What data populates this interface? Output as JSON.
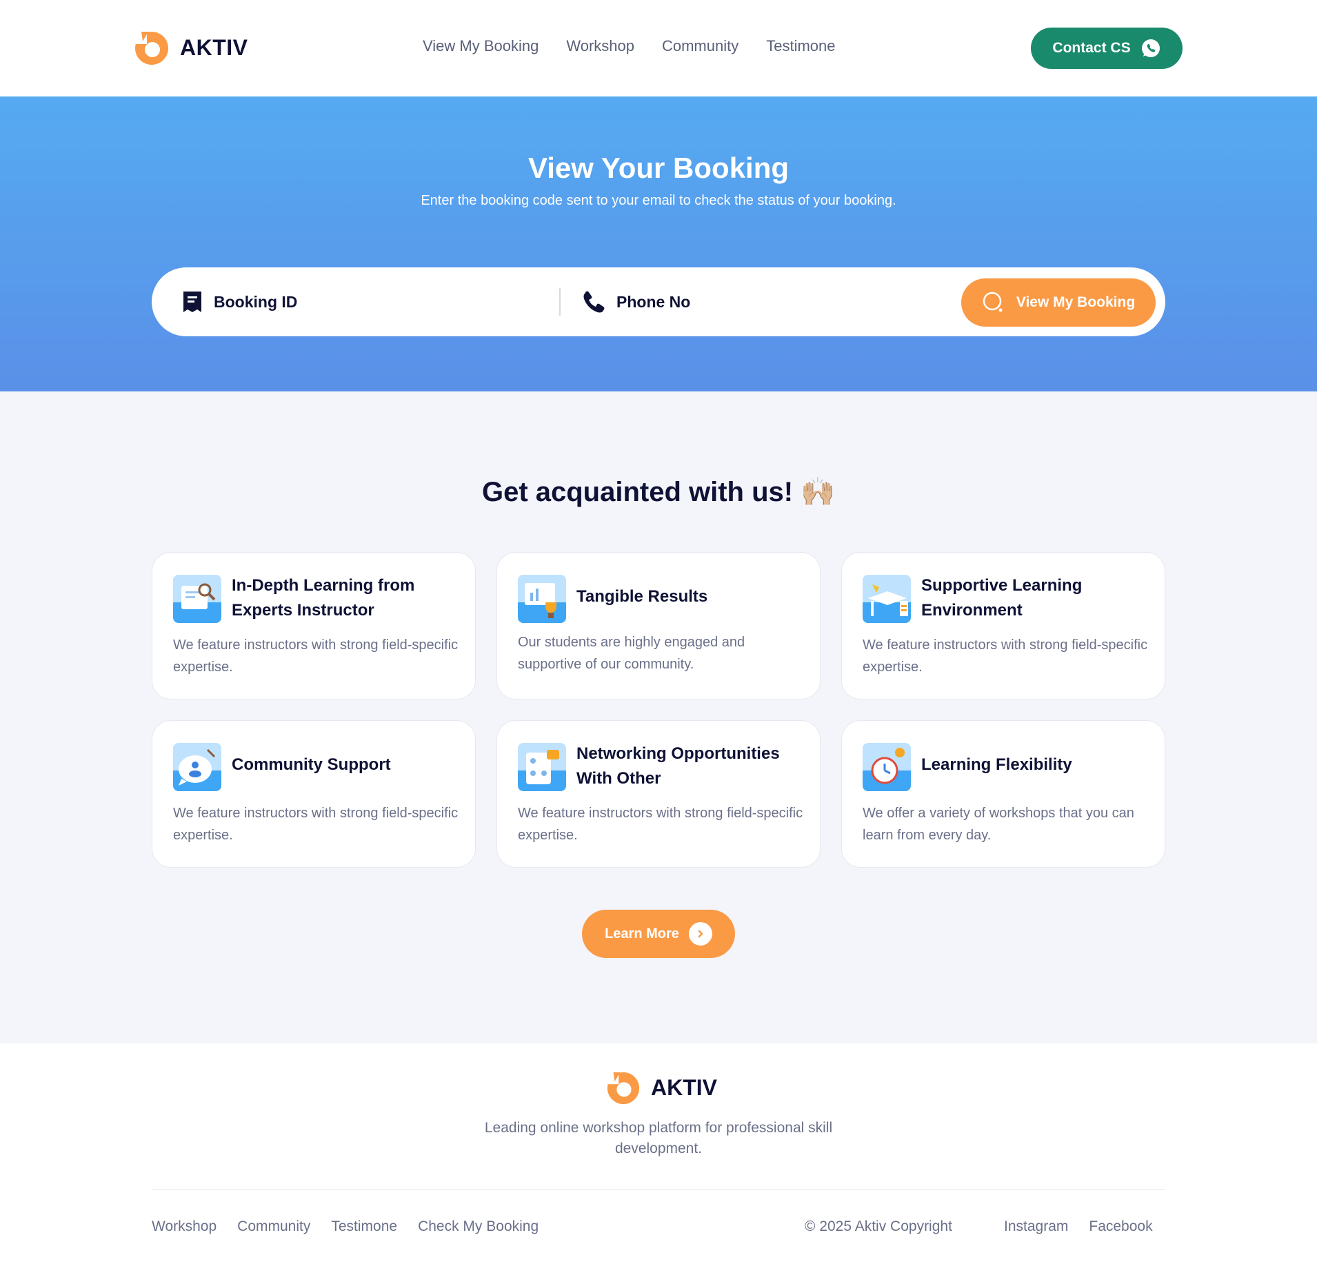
{
  "header": {
    "brand": "AKTIV",
    "nav": [
      "View My Booking",
      "Workshop",
      "Community",
      "Testimone"
    ],
    "contact_label": "Contact CS"
  },
  "hero": {
    "title": "View Your Booking",
    "subtitle": "Enter the booking code sent to your email to check the status of your booking.",
    "booking_placeholder": "Booking ID",
    "booking_value": "",
    "phone_placeholder": "Phone No",
    "phone_value": "",
    "button_label": "View My Booking"
  },
  "features": {
    "title": "Get acquainted with us!",
    "emoji": "🙌🏼",
    "cards": [
      {
        "title": "In-Depth Learning from Experts Instructor",
        "desc": "We feature instructors with strong field-specific expertise.",
        "icon": "expert-instructor-icon"
      },
      {
        "title": "Tangible Results",
        "desc": "Our students are highly engaged and supportive of our community.",
        "icon": "trophy-results-icon"
      },
      {
        "title": "Supportive Learning Environment",
        "desc": "We feature instructors with strong field-specific expertise.",
        "icon": "desk-environment-icon"
      },
      {
        "title": "Community Support",
        "desc": "We feature instructors with strong field-specific expertise.",
        "icon": "chat-community-icon"
      },
      {
        "title": "Networking Opportunities With Other",
        "desc": "We feature instructors with strong field-specific expertise.",
        "icon": "networking-card-icon"
      },
      {
        "title": "Learning Flexibility",
        "desc": "We offer a variety of workshops that you can learn from every day.",
        "icon": "alarm-clock-icon"
      }
    ],
    "learn_more": "Learn More"
  },
  "footer": {
    "brand": "AKTIV",
    "tagline": "Leading online workshop platform for professional skill development.",
    "links": [
      "Workshop",
      "Community",
      "Testimone",
      "Check My Booking"
    ],
    "copyright": "© 2025 Aktiv Copyright",
    "social": [
      "Instagram",
      "Facebook"
    ]
  },
  "colors": {
    "accent_orange": "#fb9a45",
    "contact_green": "#1a8a6c",
    "hero_top": "#55aaf1",
    "hero_bottom": "#5a90e8",
    "navy": "#0f1235"
  }
}
